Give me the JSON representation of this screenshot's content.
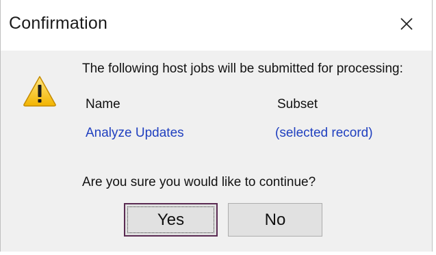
{
  "dialog": {
    "title": "Confirmation",
    "close_icon": "close-x-icon",
    "warning_icon": "warning-triangle-icon",
    "message": "The following host jobs will be submitted for processing:",
    "columns": {
      "name_header": "Name",
      "subset_header": "Subset"
    },
    "rows": [
      {
        "name": "Analyze Updates",
        "subset": "(selected record)"
      }
    ],
    "question": "Are you sure you would like to continue?",
    "buttons": {
      "yes_label": "Yes",
      "no_label": "No"
    },
    "colors": {
      "link_text": "#1f3fbf",
      "body_background": "#f0f0f0",
      "button_background": "#e1e1e1"
    }
  }
}
